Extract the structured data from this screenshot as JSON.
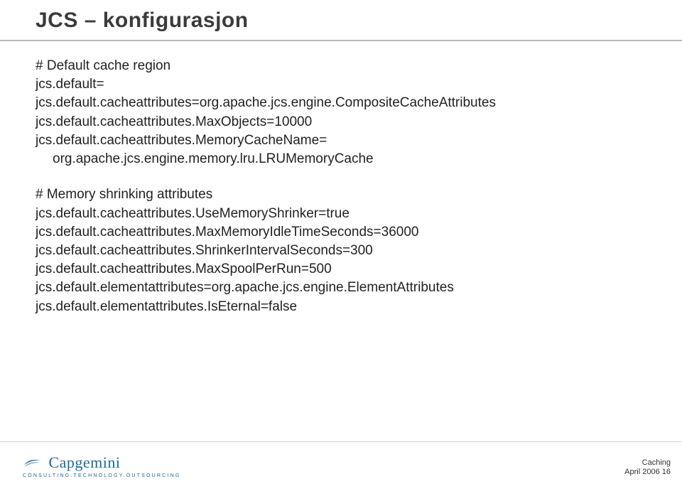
{
  "title": "JCS – konfigurasjon",
  "blocks": [
    {
      "lines": [
        {
          "text": "# Default cache region",
          "indent": false
        },
        {
          "text": "jcs.default=",
          "indent": false
        },
        {
          "text": "jcs.default.cacheattributes=org.apache.jcs.engine.CompositeCacheAttributes",
          "indent": false
        },
        {
          "text": "jcs.default.cacheattributes.MaxObjects=10000",
          "indent": false
        },
        {
          "text": "jcs.default.cacheattributes.MemoryCacheName=",
          "indent": false
        },
        {
          "text": "org.apache.jcs.engine.memory.lru.LRUMemoryCache",
          "indent": true
        }
      ]
    },
    {
      "lines": [
        {
          "text": "# Memory shrinking attributes",
          "indent": false
        },
        {
          "text": "jcs.default.cacheattributes.UseMemoryShrinker=true",
          "indent": false
        },
        {
          "text": "jcs.default.cacheattributes.MaxMemoryIdleTimeSeconds=36000",
          "indent": false
        },
        {
          "text": "jcs.default.cacheattributes.ShrinkerIntervalSeconds=300",
          "indent": false
        },
        {
          "text": "jcs.default.cacheattributes.MaxSpoolPerRun=500",
          "indent": false
        },
        {
          "text": "jcs.default.elementattributes=org.apache.jcs.engine.ElementAttributes",
          "indent": false
        },
        {
          "text": "jcs.default.elementattributes.IsEternal=false",
          "indent": false
        }
      ]
    }
  ],
  "logo": {
    "name": "Capgemini",
    "tagline": "CONSULTING.TECHNOLOGY.OUTSOURCING"
  },
  "footer": {
    "topic": "Caching",
    "date_page": "April 2006   16"
  }
}
